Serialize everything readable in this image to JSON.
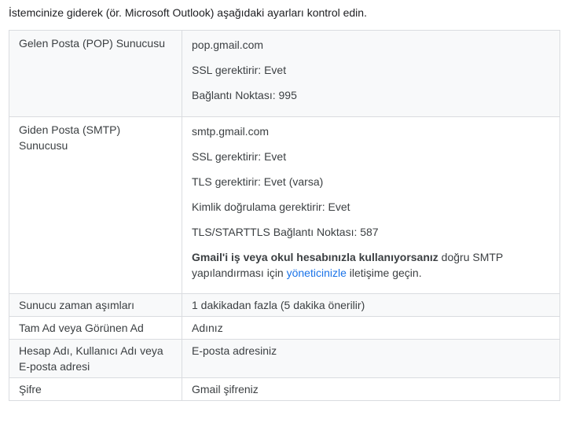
{
  "intro": "İstemcinize giderek (ör. Microsoft Outlook) aşağıdaki ayarları kontrol edin.",
  "pop": {
    "label": "Gelen Posta (POP) Sunucusu",
    "server": "pop.gmail.com",
    "ssl": "SSL gerektirir: Evet",
    "port": "Bağlantı Noktası: 995"
  },
  "smtp": {
    "label": "Giden Posta (SMTP) Sunucusu",
    "server": "smtp.gmail.com",
    "ssl": "SSL gerektirir: Evet",
    "tls": "TLS gerektirir: Evet (varsa)",
    "auth": "Kimlik doğrulama gerektirir: Evet",
    "port": "TLS/STARTTLS Bağlantı Noktası: 587",
    "note_bold": "Gmail'i iş veya okul hesabınızla kullanıyorsanız",
    "note_text_1": " doğru SMTP yapılandırması için ",
    "note_link": "yöneticinizle",
    "note_text_2": " iletişime geçin."
  },
  "timeout": {
    "label": "Sunucu zaman aşımları",
    "value": "1 dakikadan fazla (5 dakika önerilir)"
  },
  "name": {
    "label": "Tam Ad veya Görünen Ad",
    "value": "Adınız"
  },
  "account": {
    "label": "Hesap Adı, Kullanıcı Adı veya E-posta adresi",
    "value": "E-posta adresiniz"
  },
  "password": {
    "label": "Şifre",
    "value": "Gmail şifreniz"
  },
  "colors": {
    "link": "#1a73e8",
    "shaded_row": "#f8f9fa",
    "border": "#dadce0"
  }
}
